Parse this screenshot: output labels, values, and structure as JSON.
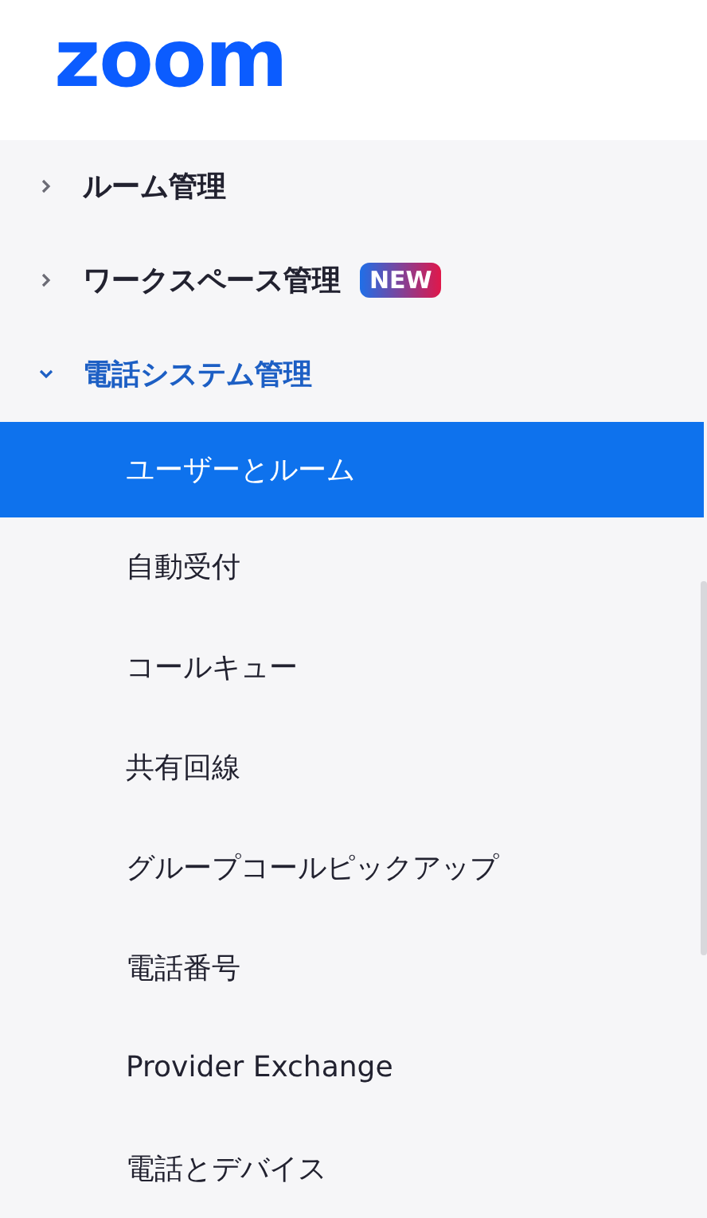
{
  "logo": "zoom",
  "nav": [
    {
      "label": "ルーム管理",
      "expanded": false
    },
    {
      "label": "ワークスペース管理",
      "expanded": false,
      "badge": "NEW"
    },
    {
      "label": "電話システム管理",
      "expanded": true,
      "children": [
        {
          "label": "ユーザーとルーム",
          "selected": true
        },
        {
          "label": "自動受付",
          "selected": false
        },
        {
          "label": "コールキュー",
          "selected": false
        },
        {
          "label": "共有回線",
          "selected": false
        },
        {
          "label": "グループコールピックアップ",
          "selected": false
        },
        {
          "label": "電話番号",
          "selected": false
        },
        {
          "label": "Provider Exchange",
          "selected": false
        },
        {
          "label": "電話とデバイス",
          "selected": false
        }
      ]
    }
  ]
}
